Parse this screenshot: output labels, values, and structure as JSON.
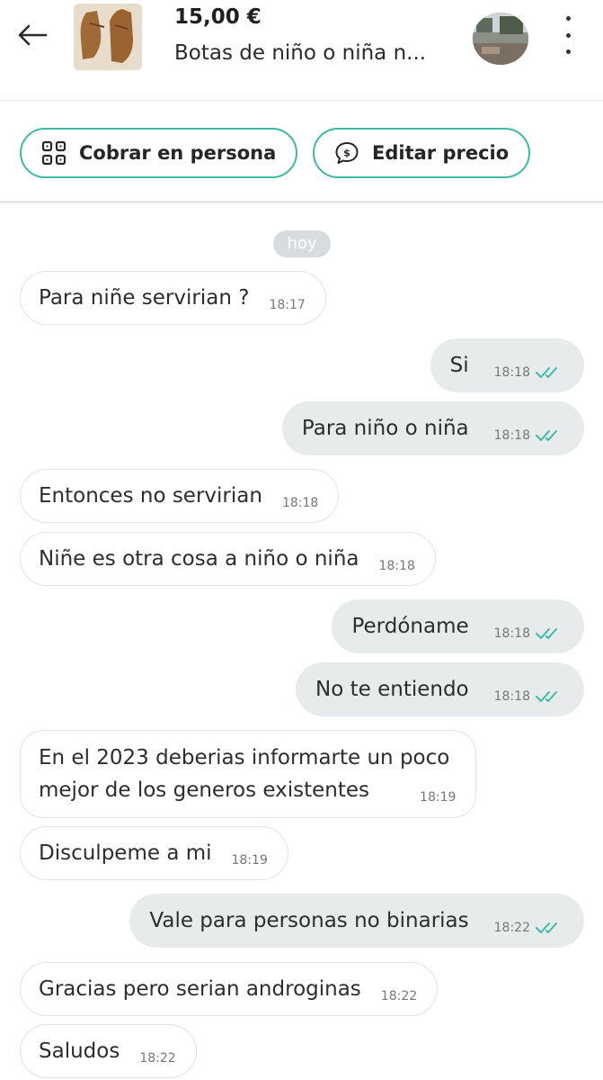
{
  "header": {
    "price": "15,00 €",
    "title": "Botas de niño o niña n..."
  },
  "actions": {
    "collect_label": "Cobrar en persona",
    "edit_price_label": "Editar precio"
  },
  "day_label": "hoy",
  "colors": {
    "accent": "#3fb9a5",
    "outgoing_bubble": "#e8ebec",
    "incoming_border": "#e3e3e3"
  },
  "messages": [
    {
      "direction": "in",
      "text": "Para niñe servirian ?",
      "time": "18:17"
    },
    {
      "direction": "out",
      "text": "Si",
      "time": "18:18",
      "read": true
    },
    {
      "direction": "out",
      "text": "Para niño o niña",
      "time": "18:18",
      "read": true
    },
    {
      "direction": "in",
      "text": "Entonces no servirian",
      "time": "18:18"
    },
    {
      "direction": "in",
      "text": "Niñe es otra cosa a niño o niña",
      "time": "18:18"
    },
    {
      "direction": "out",
      "text": "Perdóname",
      "time": "18:18",
      "read": true
    },
    {
      "direction": "out",
      "text": "No te entiendo",
      "time": "18:18",
      "read": true
    },
    {
      "direction": "in",
      "text_line1": "En el 2023 deberias informarte un poco",
      "text_line2": "mejor de los generos existentes",
      "time": "18:19"
    },
    {
      "direction": "in",
      "text": "Disculpeme a mi",
      "time": "18:19"
    },
    {
      "direction": "out",
      "text": "Vale para personas no binarias",
      "time": "18:22",
      "read": true
    },
    {
      "direction": "in",
      "text": "Gracias pero serian androginas",
      "time": "18:22"
    },
    {
      "direction": "in",
      "text": "Saludos",
      "time": "18:22"
    }
  ]
}
